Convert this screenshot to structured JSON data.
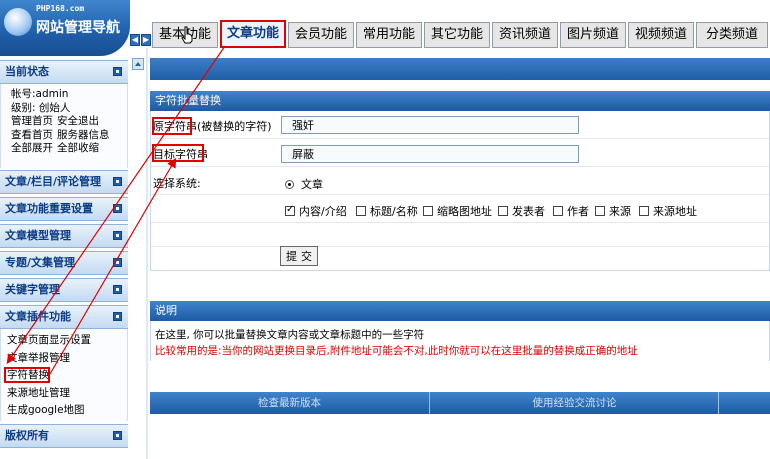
{
  "logo": {
    "small": "PHP168.com",
    "title": "网站管理导航"
  },
  "sidebar": {
    "status_title": "当前状态",
    "status_lines": [
      {
        "a": "帐号:admin"
      },
      {
        "a": "级别: 创始人"
      },
      {
        "a": "管理首页",
        "b": "安全退出"
      },
      {
        "a": "查看首页",
        "b": "服务器信息"
      },
      {
        "a": "全部展开",
        "b": "全部收缩"
      }
    ],
    "sections": [
      "文章/栏目/评论管理",
      "文章功能重要设置",
      "文章模型管理",
      "专题/文集管理",
      "关键字管理",
      "文章插件功能"
    ],
    "plugin_items": [
      "文章页面显示设置",
      "文章举报管理",
      "字符替换",
      "来源地址管理",
      "生成google地图"
    ],
    "footer_title": "版权所有"
  },
  "tabs": [
    "基本功能",
    "文章功能",
    "会员功能",
    "常用功能",
    "其它功能",
    "资讯频道",
    "图片频道",
    "视频频道",
    "分类频道"
  ],
  "form": {
    "title": "字符批量替换",
    "source_label": "原字符串",
    "source_hint": "(被替换的字符)",
    "source_value": "强奸",
    "target_label": "目标字符串",
    "target_value": "屏蔽",
    "system_label": "选择系统:",
    "system_option": "文章",
    "fields": [
      {
        "label": "内容/介绍",
        "checked": true
      },
      {
        "label": "标题/名称",
        "checked": false
      },
      {
        "label": "缩略图地址",
        "checked": false
      },
      {
        "label": "发表者",
        "checked": false
      },
      {
        "label": "作者",
        "checked": false
      },
      {
        "label": "来源",
        "checked": false
      },
      {
        "label": "来源地址",
        "checked": false
      }
    ],
    "submit_label": "提交"
  },
  "notes": {
    "title": "说明",
    "line1": "在这里, 你可以批量替换文章内容或文章标题中的一些字符",
    "line2": "比较常用的是:当你的网站更换目录后,附件地址可能会不对,此时你就可以在这里批量的替换成正确的地址"
  },
  "footer": {
    "check_update": "检查最新版本",
    "forum": "使用经验交流讨论"
  },
  "colors": {
    "accent": "#1f5ea8",
    "highlight": "#e00000"
  }
}
